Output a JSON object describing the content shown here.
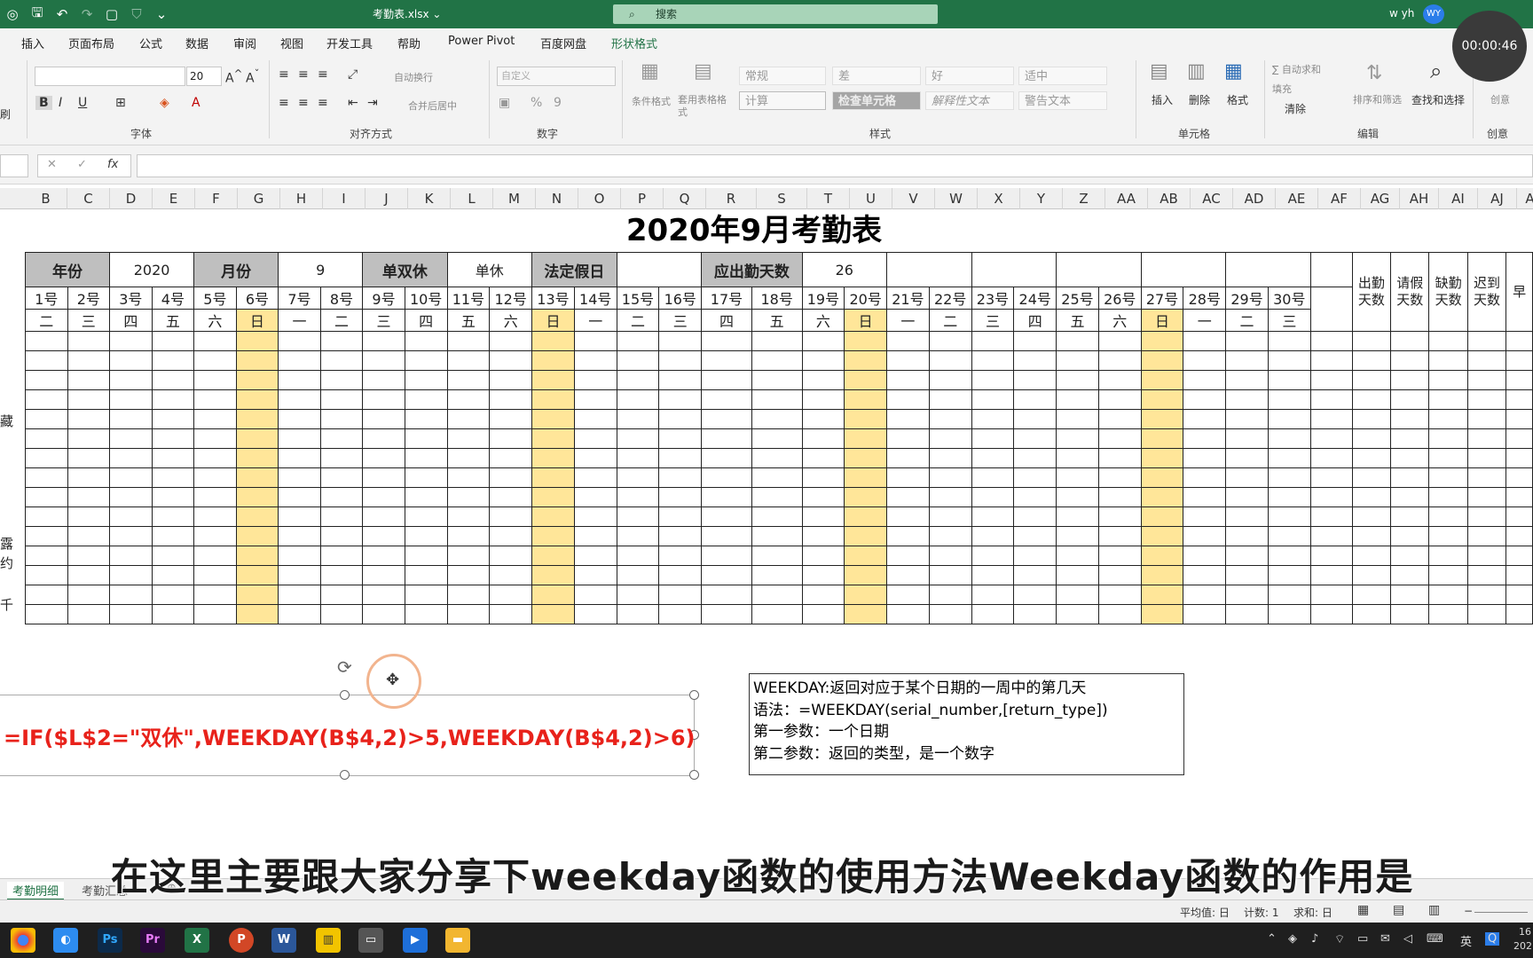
{
  "titlebar": {
    "filename": "考勤表.xlsx ⌄",
    "search_placeholder": "搜索",
    "user": "w yh",
    "avatar": "WY",
    "timer": "00:00:46"
  },
  "menu": [
    "插入",
    "页面布局",
    "公式",
    "数据",
    "审阅",
    "视图",
    "开发工具",
    "帮助",
    "Power Pivot",
    "百度网盘",
    "形状格式"
  ],
  "ribbon": {
    "font_size": "20",
    "groups": [
      "字体",
      "对齐方式",
      "数字",
      "样式",
      "单元格",
      "编辑",
      "创意"
    ],
    "wrap": "自动换行",
    "merge": "合并后居中",
    "number_format": "自定义",
    "cond_format": "条件格式",
    "table_format": "套用表格格式",
    "styles": [
      "常规",
      "差",
      "好",
      "适中",
      "计算",
      "检查单元格",
      "解释性文本",
      "警告文本"
    ],
    "insert": "插入",
    "delete": "删除",
    "format": "格式",
    "autosum": "∑ 自动求和",
    "fill": "填充",
    "clear": "清除",
    "sort": "排序和筛选",
    "find": "查找和选择",
    "creative": "创意",
    "left_label": "刷"
  },
  "formula_bar": {
    "fx": "fx"
  },
  "columns": [
    "B",
    "C",
    "D",
    "E",
    "F",
    "G",
    "H",
    "I",
    "J",
    "K",
    "L",
    "M",
    "N",
    "O",
    "P",
    "Q",
    "R",
    "S",
    "T",
    "U",
    "V",
    "W",
    "X",
    "Y",
    "Z",
    "AA",
    "AB",
    "AC",
    "AD",
    "AE",
    "AF",
    "AG",
    "AH",
    "AI",
    "AJ",
    "A"
  ],
  "sheet": {
    "title": "2020年9月考勤表",
    "year_label": "年份",
    "year_value": "2020",
    "month_label": "月份",
    "month_value": "9",
    "shift_label": "单双休",
    "shift_value": "单休",
    "holiday_label": "法定假日",
    "days_label": "应出勤天数",
    "days_value": "26",
    "days": [
      "1号",
      "2号",
      "3号",
      "4号",
      "5号",
      "6号",
      "7号",
      "8号",
      "9号",
      "10号",
      "11号",
      "12号",
      "13号",
      "14号",
      "15号",
      "16号",
      "17号",
      "18号",
      "19号",
      "20号",
      "21号",
      "22号",
      "23号",
      "24号",
      "25号",
      "26号",
      "27号",
      "28号",
      "29号",
      "30号"
    ],
    "weekdays": [
      "二",
      "三",
      "四",
      "五",
      "六",
      "日",
      "一",
      "二",
      "三",
      "四",
      "五",
      "六",
      "日",
      "一",
      "二",
      "三",
      "四",
      "五",
      "六",
      "日",
      "一",
      "二",
      "三",
      "四",
      "五",
      "六",
      "日",
      "一",
      "二",
      "三"
    ],
    "summary_headers": [
      "出勤\n天数",
      "请假\n天数",
      "缺勤\n天数",
      "迟到\n天数",
      "早"
    ],
    "side_labels": [
      "藏",
      "露",
      "约",
      "千"
    ]
  },
  "formula_shape": "=IF($L$2=\"双休\",WEEKDAY(B$4,2)>5,WEEKDAY(B$4,2)>6)",
  "info": [
    "WEEKDAY:返回对应于某个日期的一周中的第几天",
    "语法：=WEEKDAY(serial_number,[return_type])",
    "第一参数：一个日期",
    "第二参数：返回的类型，是一个数字"
  ],
  "subtitle": "在这里主要跟大家分享下weekday函数的使用方法Weekday函数的作用是",
  "sheet_tabs": [
    "考勤明细",
    "考勤汇总"
  ],
  "status": {
    "avg": "平均值: 日",
    "count": "计数: 1",
    "sum": "求和: 日"
  },
  "taskbar": {
    "lang": "英",
    "time": "16",
    "date": "202"
  },
  "colors": {
    "accent": "#217346",
    "weekend": "#ffe699",
    "header_gray": "#bfbfbf",
    "formula_red": "#e8221b"
  }
}
